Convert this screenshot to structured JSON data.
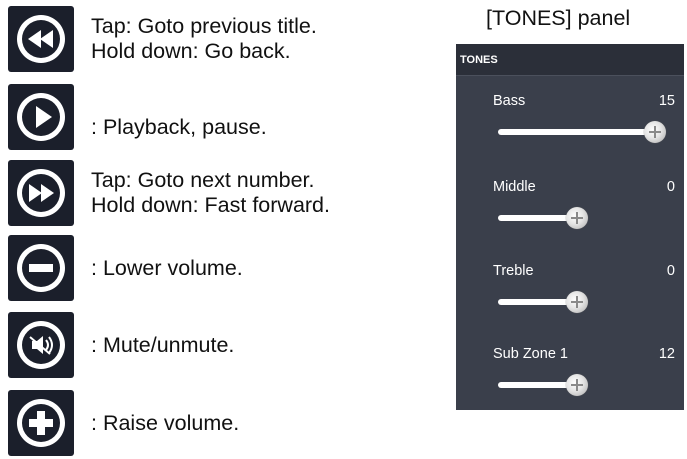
{
  "legend": [
    {
      "icon": "rewind-icon",
      "lines": [
        "Tap: Goto previous title.",
        "Hold down: Go back."
      ]
    },
    {
      "icon": "play-icon",
      "lines": [
        ": Playback, pause."
      ]
    },
    {
      "icon": "fast-forward-icon",
      "lines": [
        "Tap: Goto next number.",
        "Hold down: Fast forward."
      ]
    },
    {
      "icon": "minus-icon",
      "lines": [
        ": Lower volume."
      ]
    },
    {
      "icon": "mute-icon",
      "lines": [
        ": Mute/unmute."
      ]
    },
    {
      "icon": "plus-icon",
      "lines": [
        ": Raise volume."
      ]
    }
  ],
  "panel": {
    "caption": "[TONES] panel",
    "header": "TONES",
    "tones": [
      {
        "label": "Bass",
        "value": "15",
        "level": 1.0
      },
      {
        "label": "Middle",
        "value": "0",
        "level": 0.5
      },
      {
        "label": "Treble",
        "value": "0",
        "level": 0.5
      },
      {
        "label": "Sub Zone 1",
        "value": "12",
        "level": 0.5
      }
    ]
  },
  "colors": {
    "button_bg": "#1b1f2b",
    "panel_bg": "#3a3f4b",
    "panel_header_bg": "#2b2f39"
  }
}
